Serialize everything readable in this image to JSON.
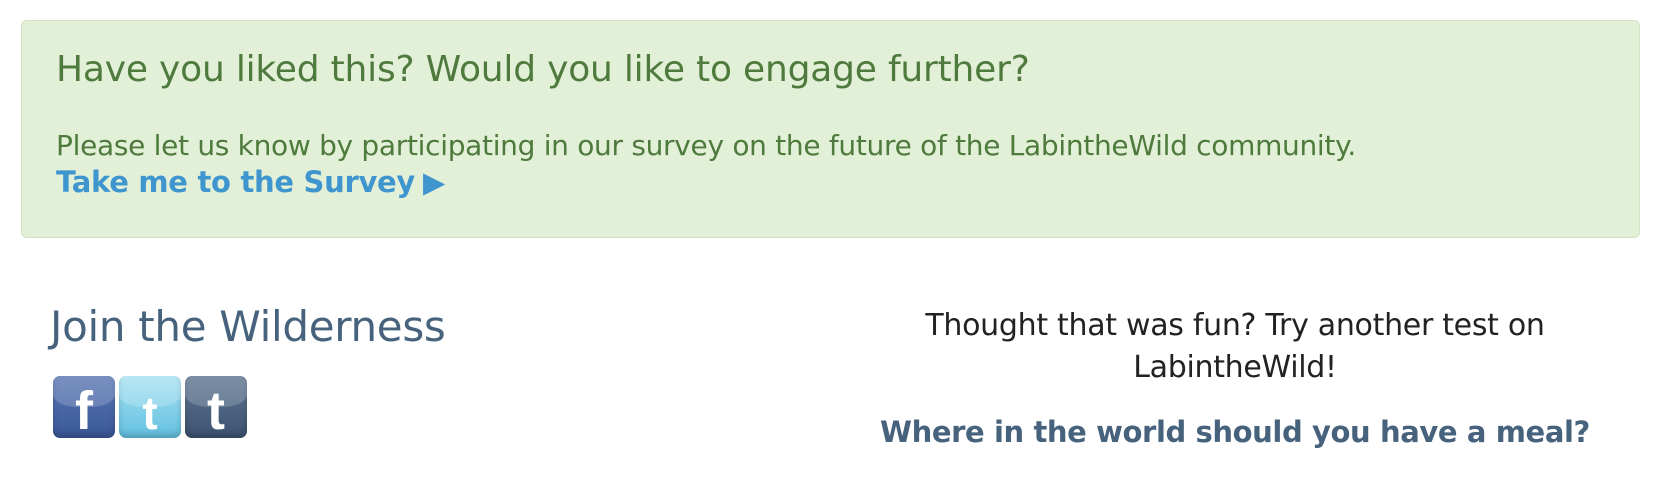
{
  "survey": {
    "title": "Have you liked this? Would you like to engage further?",
    "text": "Please let us know by participating in our survey on the future of the LabintheWild community.",
    "link_label": "Take me to the Survey",
    "link_arrow": "▶"
  },
  "join": {
    "title": "Join the Wilderness",
    "social": [
      {
        "name": "Facebook",
        "glyph": "f",
        "icon": "facebook-icon"
      },
      {
        "name": "Twitter",
        "glyph": "t",
        "icon": "twitter-icon"
      },
      {
        "name": "Tumblr",
        "glyph": "t",
        "icon": "tumblr-icon"
      }
    ]
  },
  "promo": {
    "text": "Thought that was fun? Try another test on LabintheWild!",
    "link_label": "Where in the world should you have a meal?"
  },
  "colors": {
    "survey_bg": "#e3f0d8",
    "survey_text": "#4f7a3d",
    "link_blue": "#3f96cf",
    "heading_slate": "#47627c"
  }
}
